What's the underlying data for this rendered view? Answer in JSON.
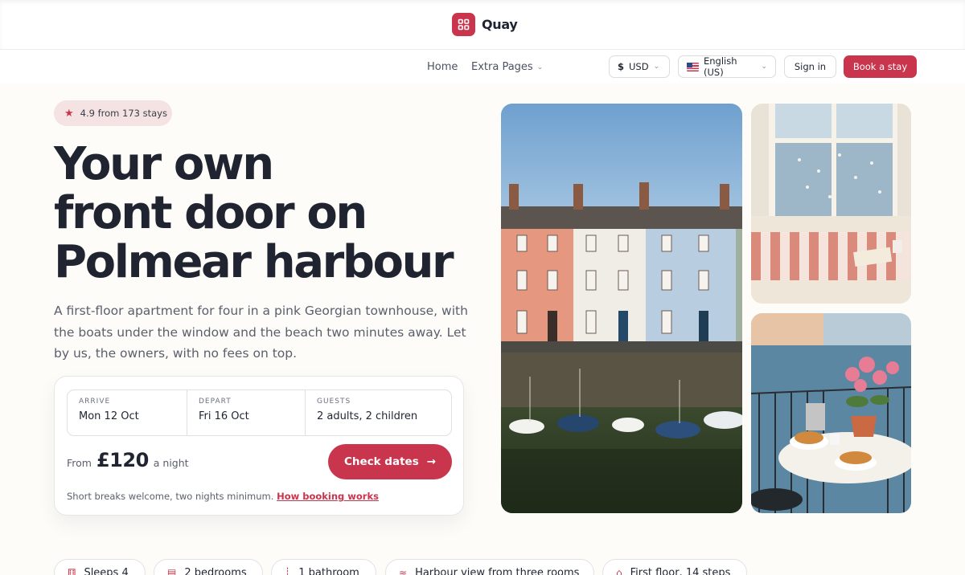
{
  "brand": {
    "name": "Quay"
  },
  "nav": {
    "home": "Home",
    "extra": "Extra Pages"
  },
  "currency": {
    "symbol": "$",
    "code": "USD"
  },
  "language": {
    "label": "English (US)"
  },
  "auth": {
    "sign_in": "Sign in"
  },
  "cta": {
    "book": "Book a stay"
  },
  "rating": {
    "text": "4.9 from 173 stays"
  },
  "hero": {
    "headline": [
      "Your own",
      "front door on",
      "Polmear harbour"
    ],
    "lede": "A first-floor apartment for four in a pink Georgian townhouse, with the boats under the window and the beach two minutes away. Let by us, the owners, with no fees on top."
  },
  "booking": {
    "arrive_label": "ARRIVE",
    "arrive_value": "Mon 12 Oct",
    "depart_label": "DEPART",
    "depart_value": "Fri 16 Oct",
    "guests_label": "GUESTS",
    "guests_value": "2 adults, 2 children",
    "from": "From",
    "price": "£120",
    "per": "a night",
    "check_label": "Check dates",
    "note": "Short breaks welcome, two nights minimum.",
    "note_link": "How booking works"
  },
  "features": [
    {
      "label": "Sleeps 4",
      "icon": "people-icon"
    },
    {
      "label": "2 bedrooms",
      "icon": "bed-icon"
    },
    {
      "label": "1 bathroom",
      "icon": "bath-icon"
    },
    {
      "label": "Harbour view from three rooms",
      "icon": "wave-icon"
    },
    {
      "label": "First floor, 14 steps",
      "icon": "house-icon"
    }
  ],
  "colors": {
    "accent": "#c8354c",
    "background": "#fdfcf8",
    "text": "#1f2430"
  }
}
